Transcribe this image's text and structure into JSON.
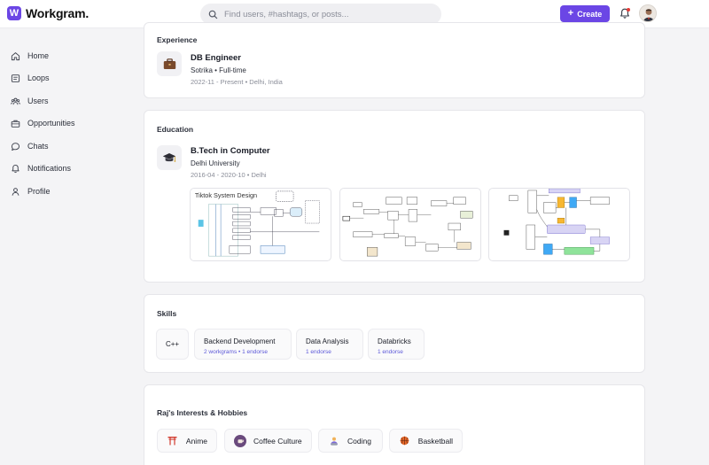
{
  "header": {
    "brand": "Workgram.",
    "brand_letter": "W",
    "search_placeholder": "Find users, #hashtags, or posts...",
    "create_label": "Create"
  },
  "sidebar": {
    "items": [
      {
        "label": "Home",
        "icon": "home-icon"
      },
      {
        "label": "Loops",
        "icon": "loops-icon"
      },
      {
        "label": "Users",
        "icon": "users-icon"
      },
      {
        "label": "Opportunities",
        "icon": "briefcase-icon"
      },
      {
        "label": "Chats",
        "icon": "chat-icon"
      },
      {
        "label": "Notifications",
        "icon": "bell-icon"
      },
      {
        "label": "Profile",
        "icon": "user-icon"
      }
    ]
  },
  "experience": {
    "title": "Experience",
    "role": "DB Engineer",
    "company_line": "Sotrika • Full-time",
    "meta": "2022-11 - Present • Delhi, India"
  },
  "education": {
    "title": "Education",
    "degree": "B.Tech in Computer",
    "school": "Delhi University",
    "meta": "2016-04 - 2020-10 • Delhi",
    "attachments": [
      {
        "caption": "Tiktok System Design"
      },
      {
        "caption": ""
      },
      {
        "caption": ""
      }
    ]
  },
  "skills": {
    "title": "Skills",
    "items": [
      {
        "name": "C++",
        "meta": ""
      },
      {
        "name": "Backend Development",
        "meta": "2 workgrams • 1 endorse"
      },
      {
        "name": "Data Analysis",
        "meta": "1 endorse"
      },
      {
        "name": "Databricks",
        "meta": "1 endorse"
      }
    ]
  },
  "hobbies": {
    "title": "Raj's Interests & Hobbies",
    "items": [
      {
        "label": "Anime",
        "icon": "torii-icon"
      },
      {
        "label": "Coffee Culture",
        "icon": "coffee-icon"
      },
      {
        "label": "Coding",
        "icon": "coder-icon"
      },
      {
        "label": "Basketball",
        "icon": "basketball-icon"
      }
    ]
  },
  "colors": {
    "accent": "#6b46e5",
    "link": "#5c58d8"
  }
}
